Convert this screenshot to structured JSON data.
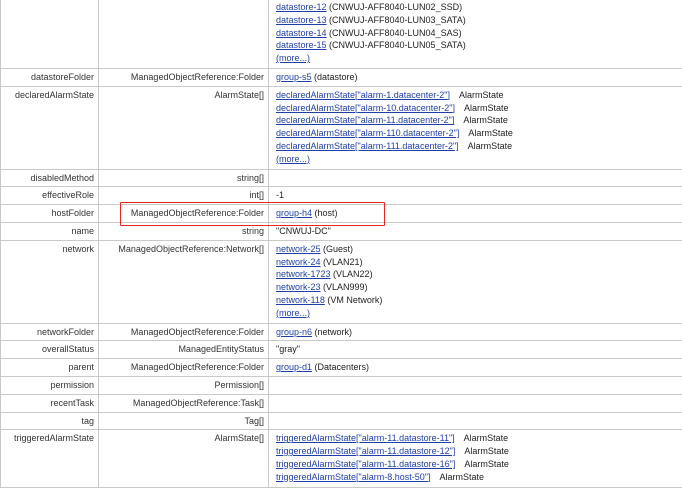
{
  "rows": {
    "datastore": {
      "name": "",
      "type": "",
      "links": [
        {
          "link": "datastore-12",
          "text": " (CNWUJ-AFF8040-LUN02_SSD)"
        },
        {
          "link": "datastore-13",
          "text": " (CNWUJ-AFF8040-LUN03_SATA)"
        },
        {
          "link": "datastore-14",
          "text": " (CNWUJ-AFF8040-LUN04_SAS)"
        },
        {
          "link": "datastore-15",
          "text": " (CNWUJ-AFF8040-LUN05_SATA)"
        }
      ],
      "more": "(more...)"
    },
    "datastoreFolder": {
      "name": "datastoreFolder",
      "type": "ManagedObjectReference:Folder",
      "link": "group-s5",
      "text": " (datastore)"
    },
    "declaredAlarmState": {
      "name": "declaredAlarmState",
      "type": "AlarmState[]",
      "items": [
        {
          "link1": "declaredAlarmState",
          "link2": "[\"alarm-1.datacenter-2\"]",
          "atype": "AlarmState"
        },
        {
          "link1": "declaredAlarmState",
          "link2": "[\"alarm-10.datacenter-2\"]",
          "atype": "AlarmState"
        },
        {
          "link1": "declaredAlarmState",
          "link2": "[\"alarm-11.datacenter-2\"]",
          "atype": "AlarmState"
        },
        {
          "link1": "declaredAlarmState",
          "link2": "[\"alarm-110.datacenter-2\"]",
          "atype": "AlarmState"
        },
        {
          "link1": "declaredAlarmState",
          "link2": "[\"alarm-111.datacenter-2\"]",
          "atype": "AlarmState"
        }
      ],
      "more": "(more...)"
    },
    "disabledMethod": {
      "name": "disabledMethod",
      "type": "string[]",
      "value": ""
    },
    "effectiveRole": {
      "name": "effectiveRole",
      "type": "int[]",
      "value": "-1"
    },
    "hostFolder": {
      "name": "hostFolder",
      "type": "ManagedObjectReference:Folder",
      "link": "group-h4",
      "text": " (host)"
    },
    "nameRow": {
      "name": "name",
      "type": "string",
      "value": "\"CNWUJ-DC\""
    },
    "network": {
      "name": "network",
      "type": "ManagedObjectReference:Network[]",
      "links": [
        {
          "link": "network-25",
          "text": " (Guest)"
        },
        {
          "link": "network-24",
          "text": " (VLAN21)"
        },
        {
          "link": "network-1723",
          "text": " (VLAN22)"
        },
        {
          "link": "network-23",
          "text": " (VLAN999)"
        },
        {
          "link": "network-118",
          "text": " (VM Network)"
        }
      ],
      "more": "(more...)"
    },
    "networkFolder": {
      "name": "networkFolder",
      "type": "ManagedObjectReference:Folder",
      "link": "group-n6",
      "text": " (network)"
    },
    "overallStatus": {
      "name": "overallStatus",
      "type": "ManagedEntityStatus",
      "value": "\"gray\""
    },
    "parent": {
      "name": "parent",
      "type": "ManagedObjectReference:Folder",
      "link": "group-d1",
      "text": " (Datacenters)"
    },
    "permission": {
      "name": "permission",
      "type": "Permission[]",
      "value": ""
    },
    "recentTask": {
      "name": "recentTask",
      "type": "ManagedObjectReference:Task[]",
      "value": ""
    },
    "tag": {
      "name": "tag",
      "type": "Tag[]",
      "value": ""
    },
    "triggeredAlarmState": {
      "name": "triggeredAlarmState",
      "type": "AlarmState[]",
      "items": [
        {
          "link1": "triggeredAlarmState",
          "link2": "[\"alarm-11.datastore-11\"]",
          "atype": "AlarmState"
        },
        {
          "link1": "triggeredAlarmState",
          "link2": "[\"alarm-11.datastore-12\"]",
          "atype": "AlarmState"
        },
        {
          "link1": "triggeredAlarmState",
          "link2": "[\"alarm-11.datastore-16\"]",
          "atype": "AlarmState"
        },
        {
          "link1": "triggeredAlarmState",
          "link2": "[\"alarm-8.host-50\"]",
          "atype": "AlarmState"
        }
      ]
    }
  },
  "highlight_color": "#e5271e",
  "link_color": "#1f3fa8"
}
